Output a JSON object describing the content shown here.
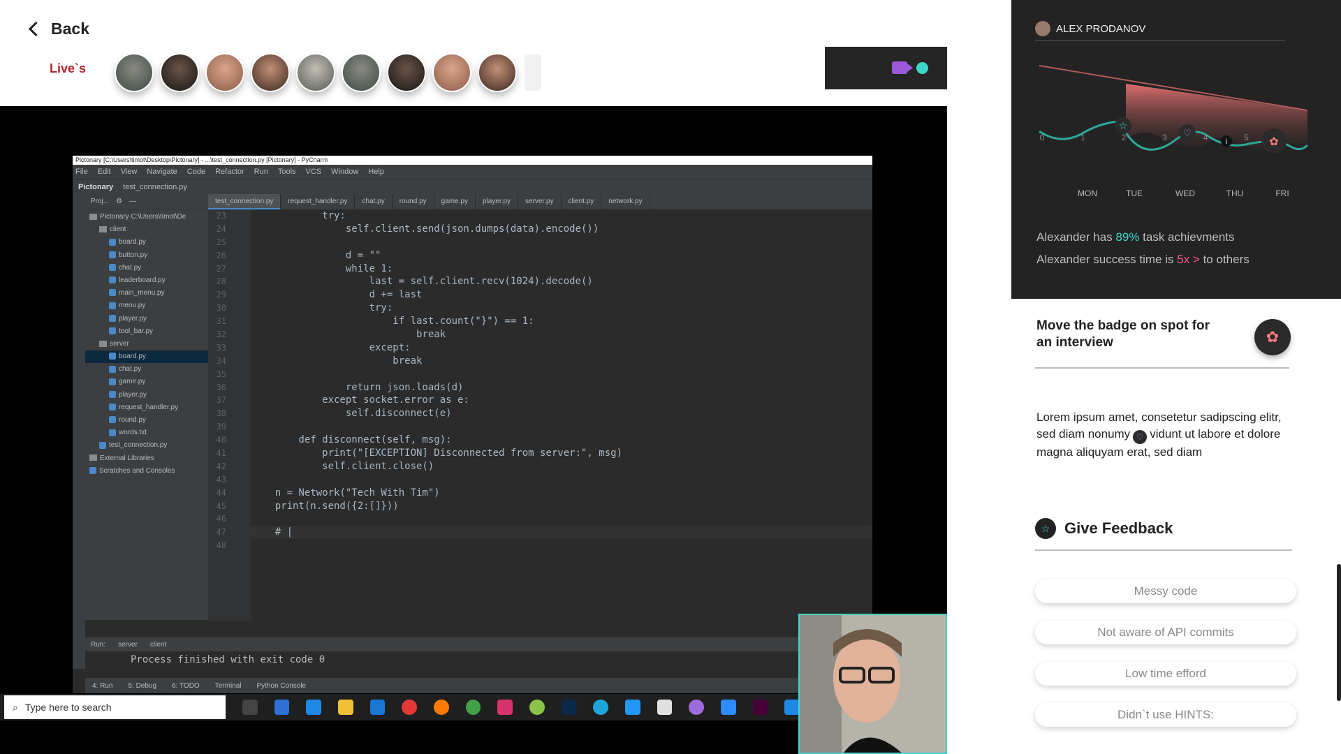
{
  "nav": {
    "back_label": "Back"
  },
  "lives": {
    "label": "Live`s",
    "avatar_count": 9
  },
  "ide": {
    "title": "Pictonary [C:\\Users\\timot\\Desktop\\Pictonary] - ...\\test_connection.py [Pictonary] - PyCharm",
    "menu": [
      "File",
      "Edit",
      "View",
      "Navigate",
      "Code",
      "Refactor",
      "Run",
      "Tools",
      "VCS",
      "Window",
      "Help"
    ],
    "crumb_project": "Pictonary",
    "crumb_file": "test_connection.py",
    "project_header": "Proj...",
    "tree": [
      {
        "label": "Pictonary  C:\\Users\\timot\\De",
        "indent": 0,
        "kind": "folder"
      },
      {
        "label": "client",
        "indent": 1,
        "kind": "folder"
      },
      {
        "label": "board.py",
        "indent": 2,
        "kind": "file"
      },
      {
        "label": "button.py",
        "indent": 2,
        "kind": "file"
      },
      {
        "label": "chat.py",
        "indent": 2,
        "kind": "file"
      },
      {
        "label": "leaderboard.py",
        "indent": 2,
        "kind": "file"
      },
      {
        "label": "main_menu.py",
        "indent": 2,
        "kind": "file"
      },
      {
        "label": "menu.py",
        "indent": 2,
        "kind": "file"
      },
      {
        "label": "player.py",
        "indent": 2,
        "kind": "file"
      },
      {
        "label": "tool_bar.py",
        "indent": 2,
        "kind": "file"
      },
      {
        "label": "server",
        "indent": 1,
        "kind": "folder"
      },
      {
        "label": "board.py",
        "indent": 2,
        "kind": "file",
        "selected": true
      },
      {
        "label": "chat.py",
        "indent": 2,
        "kind": "file"
      },
      {
        "label": "game.py",
        "indent": 2,
        "kind": "file"
      },
      {
        "label": "player.py",
        "indent": 2,
        "kind": "file"
      },
      {
        "label": "request_handler.py",
        "indent": 2,
        "kind": "file"
      },
      {
        "label": "round.py",
        "indent": 2,
        "kind": "file"
      },
      {
        "label": "words.txt",
        "indent": 2,
        "kind": "file"
      },
      {
        "label": "test_connection.py",
        "indent": 1,
        "kind": "file"
      },
      {
        "label": "External Libraries",
        "indent": 0,
        "kind": "folder"
      },
      {
        "label": "Scratches and Consoles",
        "indent": 0,
        "kind": "file"
      }
    ],
    "tabs": [
      "test_connection.py",
      "request_handler.py",
      "chat.py",
      "round.py",
      "game.py",
      "player.py",
      "server.py",
      "client.py",
      "network.py"
    ],
    "line_numbers": [
      "23",
      "24",
      "25",
      "26",
      "27",
      "28",
      "29",
      "30",
      "31",
      "32",
      "33",
      "34",
      "35",
      "36",
      "37",
      "38",
      "39",
      "40",
      "41",
      "42",
      "43",
      "44",
      "45",
      "46",
      "47",
      "48"
    ],
    "code_lines": [
      "            try:",
      "                self.client.send(json.dumps(data).encode())",
      "",
      "                d = \"\"",
      "                while 1:",
      "                    last = self.client.recv(1024).decode()",
      "                    d += last",
      "                    try:",
      "                        if last.count(\"}\") == 1:",
      "                            break",
      "                    except:",
      "                        break",
      "",
      "                return json.loads(d)",
      "            except socket.error as e:",
      "                self.disconnect(e)",
      "",
      "        def disconnect(self, msg):",
      "            print(\"[EXCEPTION] Disconnected from server:\", msg)",
      "            self.client.close()",
      "",
      "    n = Network(\"Tech With Tim\")",
      "    print(n.send({2:[]}))",
      "",
      "    # |",
      ""
    ],
    "run_label": "Run:",
    "run_tabs": [
      "server",
      "client"
    ],
    "run_output": "Process finished with exit code 0",
    "bottom_tools": [
      "4: Run",
      "5: Debug",
      "6: TODO",
      "Terminal",
      "Python Console"
    ]
  },
  "taskbar": {
    "search_placeholder": "Type here to search"
  },
  "panel": {
    "user_name": "ALEX PRODANOV",
    "chart_data": {
      "type": "line",
      "x_ticks": [
        "0",
        "1",
        "2",
        "3",
        "4",
        "5"
      ],
      "day_labels": [
        "MON",
        "TUE",
        "WED",
        "THU",
        "FRI"
      ]
    },
    "stat1_pre": "Alexander has ",
    "stat1_value": "89%",
    "stat1_post": " task achievments",
    "stat2_pre": "Alexander success time is ",
    "stat2_value": "5x >",
    "stat2_post": " to others",
    "badge_title": "Move the badge on spot for an interview",
    "lorem_a": "Lorem ipsum amet, consetetur sadipscing elitr, sed diam nonumy",
    "lorem_b": "vidunt ut labore et dolore magna aliquyam erat, sed diam",
    "feedback_title": "Give Feedback",
    "feedback_options": [
      "Messy code",
      "Not aware of API commits",
      "Low time efford",
      "Didn`t use HINTS:"
    ]
  },
  "colors": {
    "accent_teal": "#3dd6c8",
    "accent_pink": "#ff5a8a",
    "brand_red": "#b4232e",
    "purple": "#9b59d9"
  }
}
